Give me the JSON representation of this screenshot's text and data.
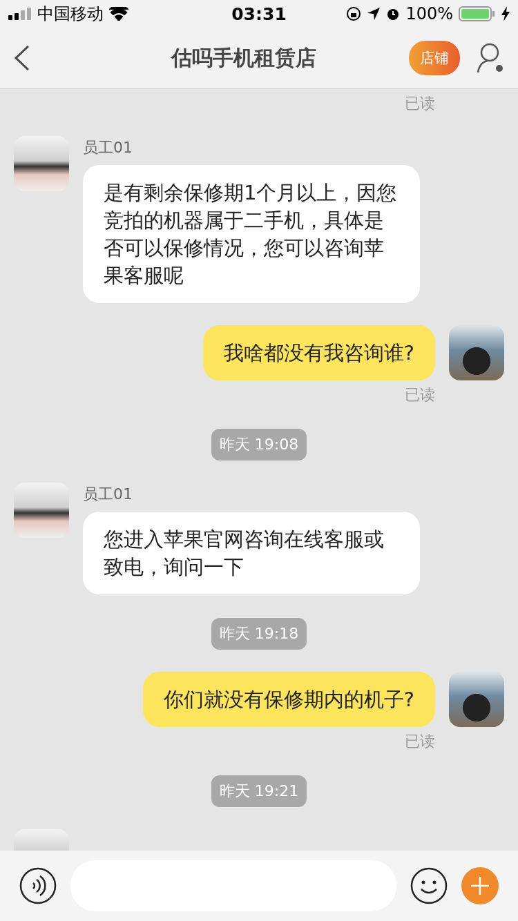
{
  "status_bar": {
    "carrier": "中国移动",
    "time": "03:31",
    "battery": "100%"
  },
  "nav": {
    "title": "估吗手机租赁店",
    "shop_button": "店铺"
  },
  "messages": [
    {
      "kind": "read",
      "text": "已读"
    },
    {
      "kind": "incoming",
      "sender": "员工01",
      "text": "是有剩余保修期1个月以上，因您竞拍的机器属于二手机，具体是否可以保修情况，您可以咨询苹果客服呢"
    },
    {
      "kind": "outgoing",
      "text": "我啥都没有我咨询谁?"
    },
    {
      "kind": "read",
      "text": "已读"
    },
    {
      "kind": "time",
      "text": "昨天 19:08"
    },
    {
      "kind": "incoming",
      "sender": "员工01",
      "text": "您进入苹果官网咨询在线客服或致电，询问一下"
    },
    {
      "kind": "time",
      "text": "昨天 19:18"
    },
    {
      "kind": "outgoing",
      "text": "你们就没有保修期内的机子?"
    },
    {
      "kind": "read",
      "text": "已读"
    },
    {
      "kind": "time",
      "text": "昨天 19:21"
    },
    {
      "kind": "incoming"
    }
  ]
}
